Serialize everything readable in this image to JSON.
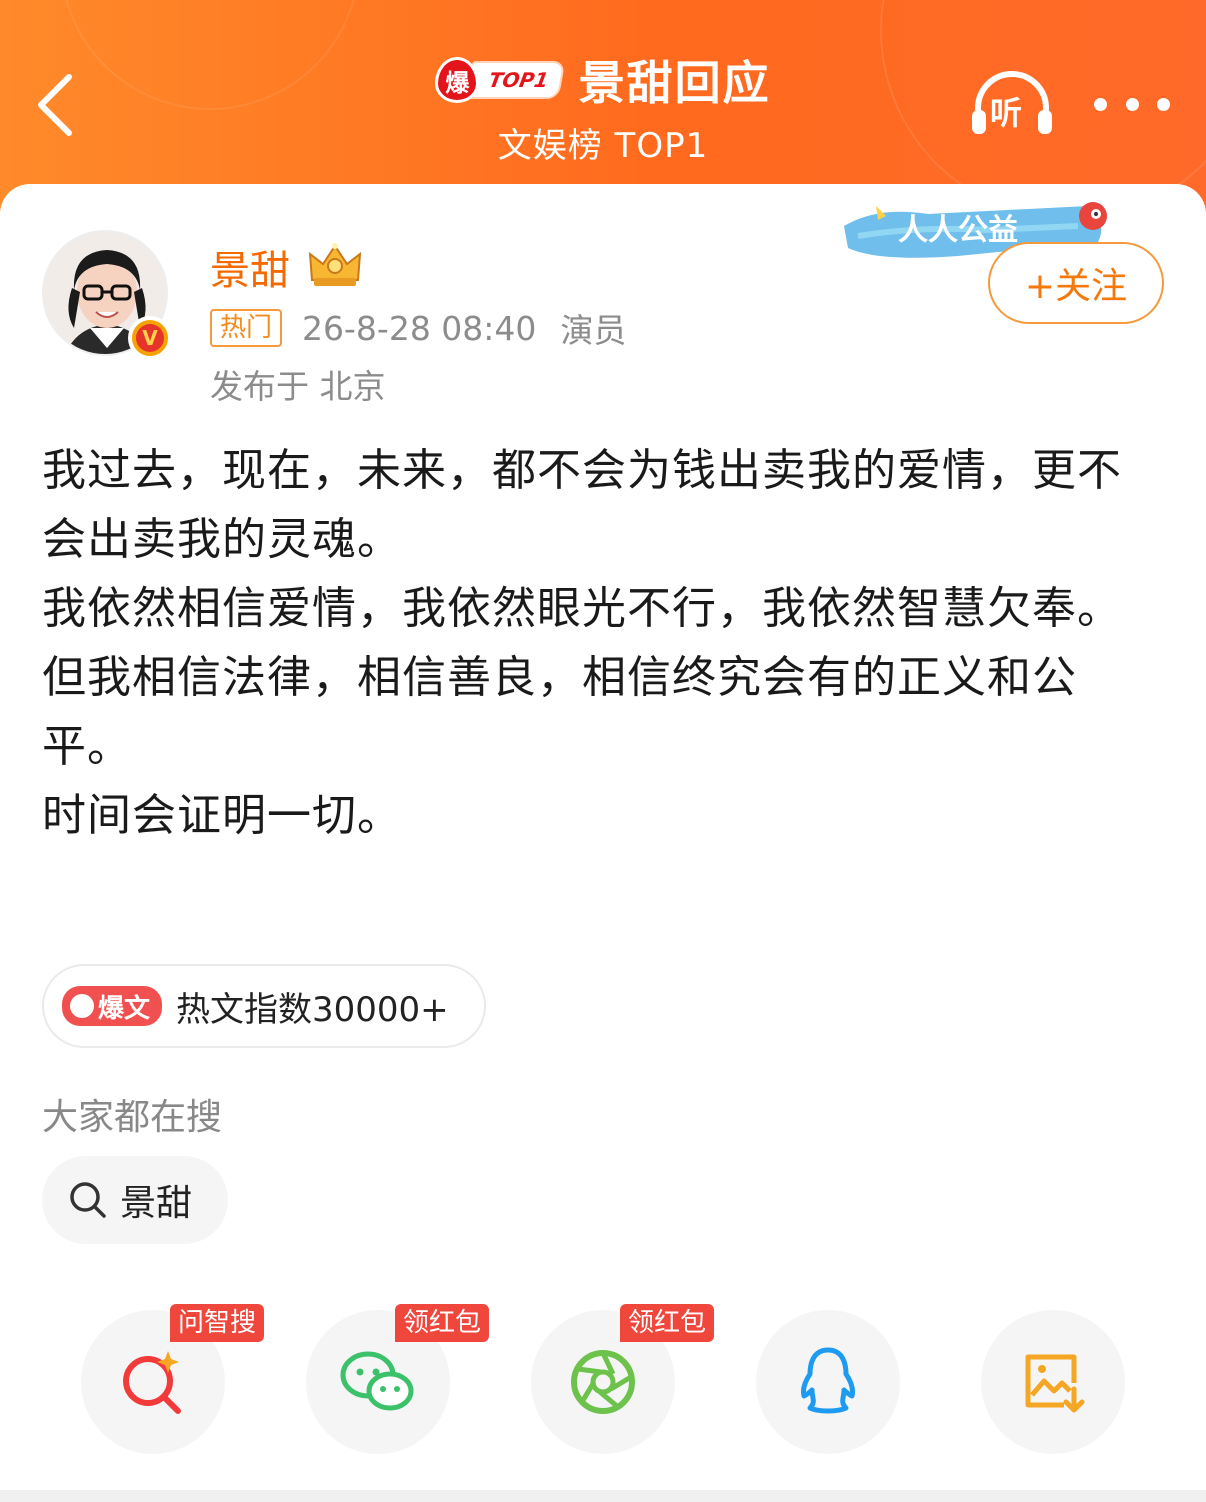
{
  "header": {
    "badge_flame": "爆",
    "badge_top": "TOP1",
    "title": "景甜回应",
    "subtitle": "文娱榜 TOP1",
    "listen_label": "听"
  },
  "post": {
    "username": "景甜",
    "hot_tag": "热门",
    "time": "26-8-28 08:40",
    "role": "演员",
    "location": "发布于 北京",
    "follow_label": "+关注",
    "verified_mark": "V",
    "paragraphs": [
      "我过去，现在，未来，都不会为钱出卖我的爱情，更不会出卖我的灵魂。",
      "我依然相信爱情，我依然眼光不行，我依然智慧欠奉。",
      "但我相信法律，相信善良，相信终究会有的正义和公平。",
      "时间会证明一切。"
    ]
  },
  "charity": {
    "text": "人人公益"
  },
  "hot_index": {
    "tag": "爆文",
    "text": "热文指数30000+"
  },
  "search": {
    "heading": "大家都在搜",
    "chip": "景甜"
  },
  "share": [
    {
      "icon": "ai-search-icon",
      "badge": "问智搜",
      "color": "#f23a3a"
    },
    {
      "icon": "wechat-icon",
      "badge": "领红包",
      "color": "#3cc16b"
    },
    {
      "icon": "moments-icon",
      "badge": "领红包",
      "color": "#6cc24a"
    },
    {
      "icon": "qq-icon",
      "badge": "",
      "color": "#1e9bf0"
    },
    {
      "icon": "save-image-icon",
      "badge": "",
      "color": "#f5a623"
    }
  ]
}
